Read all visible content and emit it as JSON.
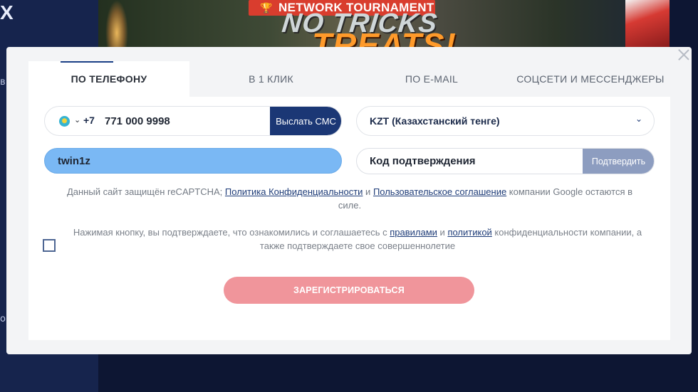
{
  "background": {
    "logo": "X",
    "side_text_1": "в",
    "side_text_2": "о",
    "banner_ribbon": "NETWORK TOURNAMENT",
    "banner_title_1": "NO TRICKS",
    "banner_title_2": "TREATS!"
  },
  "tabs": [
    {
      "label": "ПО ТЕЛЕФОНУ",
      "active": true
    },
    {
      "label": "В 1 КЛИК",
      "active": false
    },
    {
      "label": "ПО E-MAIL",
      "active": false
    },
    {
      "label": "СОЦСЕТИ И МЕССЕНДЖЕРЫ",
      "active": false
    }
  ],
  "phone": {
    "country_code": "+7",
    "value": "771 000 9998",
    "send_sms_label": "Выслать СМС"
  },
  "currency": {
    "selected": "KZT (Казахстанский тенге)"
  },
  "login": {
    "value": "twin1z"
  },
  "confirm_code": {
    "placeholder": "Код подтверждения",
    "confirm_label": "Подтвердить"
  },
  "recaptcha_notice": {
    "prefix": "Данный сайт защищён reCAPTCHA; ",
    "privacy_link": "Политика Конфиденциальности",
    "middle": " и ",
    "terms_link": "Пользовательское соглашение",
    "suffix": " компании Google остаются в силе."
  },
  "agreement": {
    "prefix": "Нажимая кнопку, вы подтверждаете, что ознакомились и соглашаетесь с ",
    "rules_link": "правилами",
    "middle": " и ",
    "policy_link": "политикой",
    "suffix": " конфиденциальности компании, а также подтверждаете свое совершеннолетие",
    "checked": false
  },
  "register_label": "ЗАРЕГИСТРИРОВАТЬСЯ",
  "colors": {
    "primary": "#1b3775",
    "register_button": "#f0959b",
    "login_field": "#7ab8f4",
    "confirm_button": "#8d9dc0"
  }
}
